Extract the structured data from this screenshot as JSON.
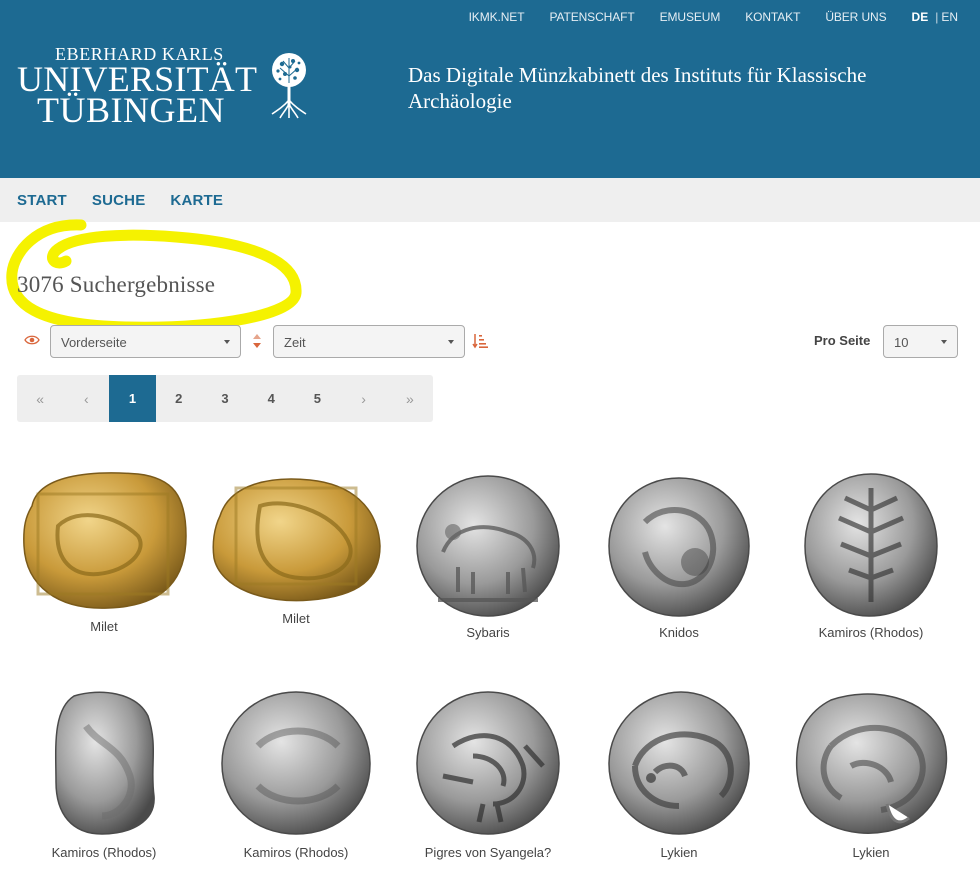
{
  "topnav": {
    "links": [
      "IKMK.NET",
      "PATENSCHAFT",
      "EMUSEUM",
      "KONTAKT",
      "ÜBER UNS"
    ],
    "lang_active": "DE",
    "lang_other": "EN"
  },
  "logo": {
    "line1": "EBERHARD KARLS",
    "line2": "UNIVERSITÄT",
    "line3": "TÜBINGEN",
    "icon": "tree-icon"
  },
  "site_title": "Das Digitale Münzkabinett des Instituts für Klassische Archäologie",
  "mainnav": [
    "START",
    "SUCHE",
    "KARTE"
  ],
  "results": {
    "title": "3076 Suchergebnisse"
  },
  "controls": {
    "side_select": "Vorderseite",
    "sort_select": "Zeit",
    "perpage_label": "Pro Seite",
    "perpage_value": "10"
  },
  "pagination": {
    "first": "«",
    "prev": "‹",
    "pages": [
      "1",
      "2",
      "3",
      "4",
      "5"
    ],
    "active": "1",
    "next": "›",
    "last": "»"
  },
  "coins": [
    {
      "label": "Milet",
      "metal": "gold"
    },
    {
      "label": "Milet",
      "metal": "gold"
    },
    {
      "label": "Sybaris",
      "metal": "silver"
    },
    {
      "label": "Knidos",
      "metal": "silver"
    },
    {
      "label": "Kamiros (Rhodos)",
      "metal": "silver"
    },
    {
      "label": "Kamiros (Rhodos)",
      "metal": "silver"
    },
    {
      "label": "Kamiros (Rhodos)",
      "metal": "silver"
    },
    {
      "label": "Pigres von Syangela?",
      "metal": "silver"
    },
    {
      "label": "Lykien",
      "metal": "silver"
    },
    {
      "label": "Lykien",
      "metal": "silver"
    }
  ],
  "colors": {
    "header_bg": "#1d6a92",
    "nav_bg": "#efefef",
    "highlight": "#f5f200",
    "accent_sort": "#d9663c"
  }
}
